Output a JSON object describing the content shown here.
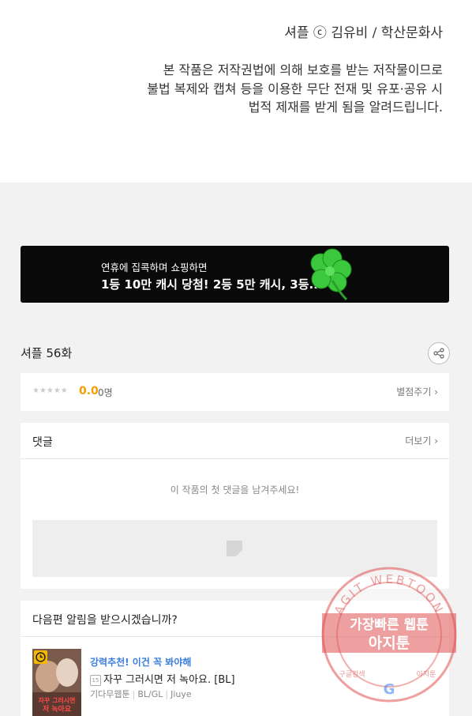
{
  "copyright": "셔플 ⓒ 김유비 / 학산문화사",
  "notice_lines": [
    "본 작품은 저작권법에 의해 보호를 받는 저작물이므로",
    "불법 복제와 캡쳐 등을 이용한 무단 전재 및 유포·공유 시",
    "법적 제재를 받게 됨을 알려드립니다."
  ],
  "banner": {
    "line1": "연휴에 집콕하며 쇼핑하면",
    "line2": "1등 10만 캐시 당첨! 2등 5만 캐시, 3등.."
  },
  "episode": {
    "title": "셔플 56화"
  },
  "rating": {
    "stars": "★★★★★",
    "score": "0.0",
    "count": "0명",
    "rate_link": "별점주기 ›"
  },
  "comments": {
    "header": "댓글",
    "more": "더보기 ›",
    "empty": "이 작품의 첫 댓글을 남겨주세요!"
  },
  "notify": {
    "header": "다음편 알림을 받으시겠습니까?"
  },
  "recommendation": {
    "label": "강력추천! 이건 꼭 봐야해",
    "age": "15",
    "title": "자꾸 그러시면 저 녹아요. [BL]",
    "meta": [
      "기다무웹툰",
      "BL/GL",
      "Jiuye"
    ],
    "thumb_text": "자꾸 그러시면 저 녹아요"
  },
  "watermark": {
    "ring_text": "AGIT WEBTOON",
    "line1": "가장빠른 웹툰",
    "line2": "아지툰",
    "bottom_left": "구글검색",
    "bottom_right": "아지툰"
  },
  "colors": {
    "accent_score": "#f5a000",
    "link_blue": "#3a7de0",
    "watermark_red": "#e05050"
  }
}
